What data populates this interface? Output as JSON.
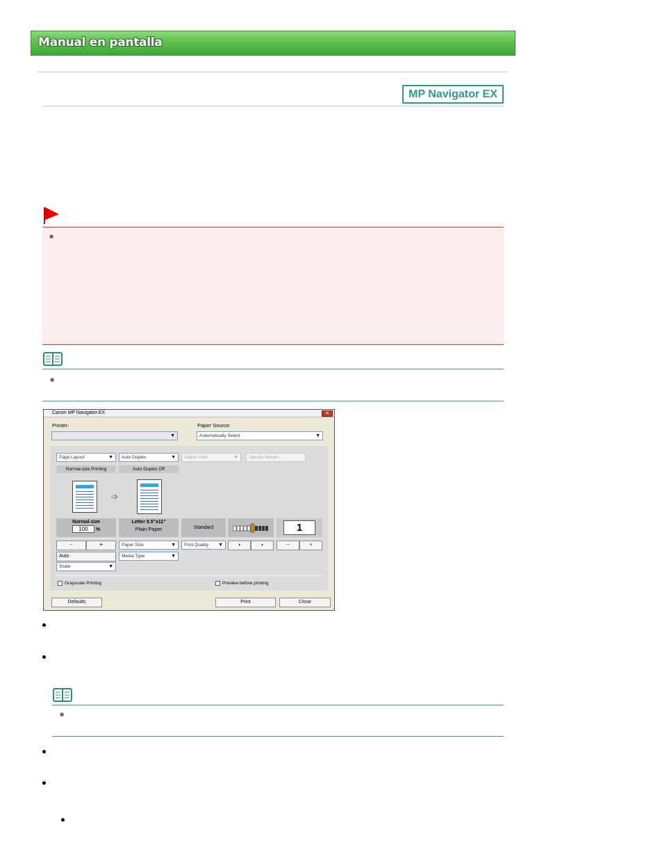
{
  "header": {
    "title": "Manual en pantalla"
  },
  "badge": {
    "label": "MP Navigator EX"
  },
  "dialog": {
    "title": "Canon MP Navigator EX",
    "printer_label": "Printer:",
    "printer_value": "",
    "paper_source_label": "Paper Source:",
    "paper_source_value": "Automatically Select",
    "page_layout": "Page Layout",
    "auto_duplex": "Auto Duplex",
    "staple_side": "Staple Side",
    "specify_margin": "Specify Margin...",
    "normal_size_printing": "Normal-size Printing",
    "auto_duplex_off": "Auto Duplex Off",
    "arrow_icon": "right-arrow",
    "normal_size": "Normal-size",
    "scale_value": "100",
    "percent": "%",
    "letter_size": "Letter 8.5\"x11\"",
    "plain_paper": "Plain Paper",
    "standard": "Standard",
    "copies": "1",
    "minus": "−",
    "plus": "+",
    "paper_size": "Paper Size",
    "print_quality": "Print Quality",
    "auto": "Auto",
    "media_type": "Media Type",
    "scale": "Scale",
    "grayscale_printing": "Grayscale Printing",
    "preview_before_printing": "Preview before printing",
    "defaults": "Defaults",
    "print": "Print",
    "close": "Close"
  },
  "colors": {
    "banner": "#5ec04f",
    "accent_teal": "#2e9a8a",
    "important_red": "#dd2222"
  }
}
